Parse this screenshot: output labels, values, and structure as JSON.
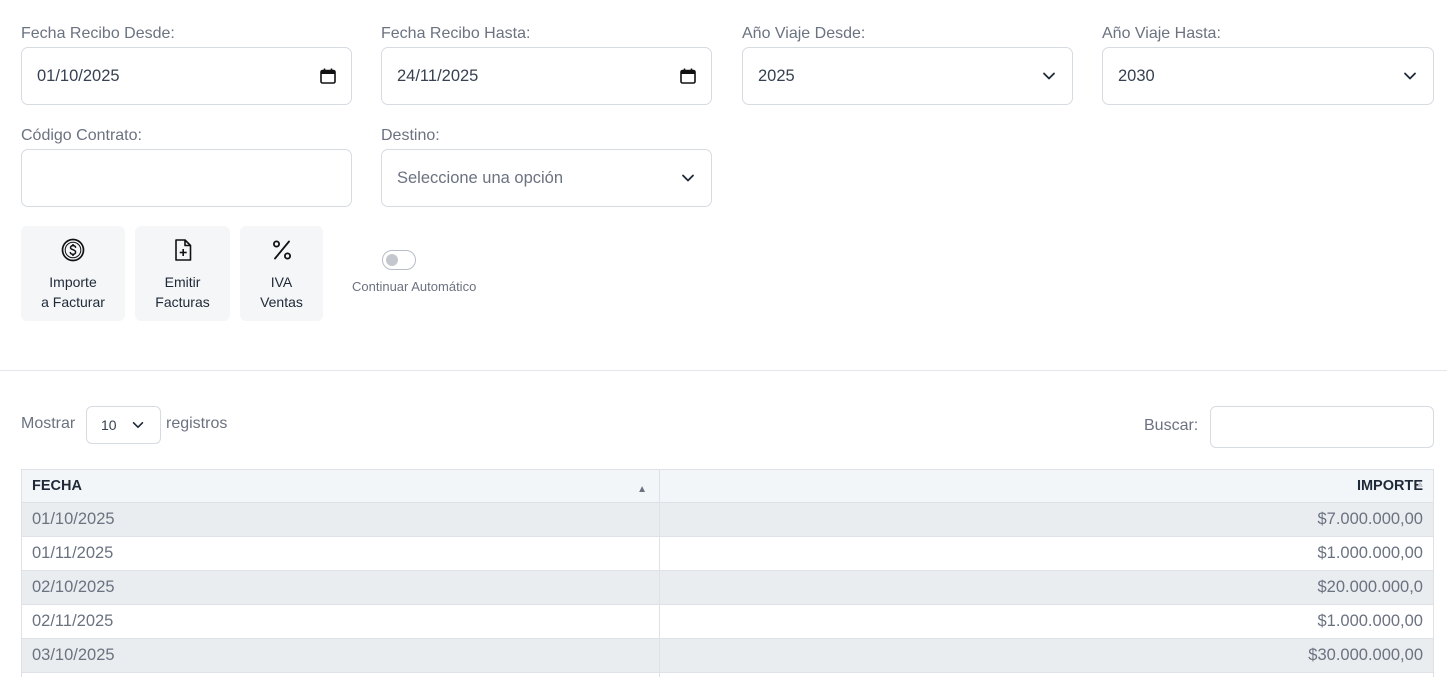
{
  "filters": {
    "fecha_desde": {
      "label": "Fecha Recibo Desde:",
      "value": "01/10/2025"
    },
    "fecha_hasta": {
      "label": "Fecha Recibo Hasta:",
      "value": "24/11/2025"
    },
    "anio_desde": {
      "label": "Año Viaje Desde:",
      "value": "2025"
    },
    "anio_hasta": {
      "label": "Año Viaje Hasta:",
      "value": "2030"
    },
    "codigo_contrato": {
      "label": "Código Contrato:",
      "value": ""
    },
    "destino": {
      "label": "Destino:",
      "placeholder": "Seleccione una opción"
    }
  },
  "actions": {
    "importe": {
      "line1": "Importe",
      "line2": "a Facturar",
      "icon": "dollar-circle-icon"
    },
    "emitir": {
      "line1": "Emitir",
      "line2": "Facturas",
      "icon": "file-plus-icon"
    },
    "iva": {
      "line1": "IVA",
      "line2": "Ventas",
      "icon": "percent-icon"
    }
  },
  "auto_toggle": {
    "label": "Continuar Automático",
    "checked": false
  },
  "table_controls": {
    "show_label": "Mostrar",
    "page_length": "10",
    "records_label": "registros",
    "search_label": "Buscar:",
    "search_value": ""
  },
  "table": {
    "headers": {
      "fecha": "FECHA",
      "importe": "IMPORTE"
    },
    "rows": [
      {
        "fecha": "01/10/2025",
        "importe": "$7.000.000,00"
      },
      {
        "fecha": "01/11/2025",
        "importe": "$1.000.000,00"
      },
      {
        "fecha": "02/10/2025",
        "importe": "$20.000.000,0"
      },
      {
        "fecha": "02/11/2025",
        "importe": "$1.000.000,00"
      },
      {
        "fecha": "03/10/2025",
        "importe": "$30.000.000,00"
      },
      {
        "fecha": "",
        "importe": ""
      }
    ]
  },
  "colors": {
    "text": "#6b7280",
    "dark_text": "#1f2937",
    "border": "#d6dbe2",
    "button_bg": "#f4f6f8",
    "row_odd": "#e9edf0"
  }
}
